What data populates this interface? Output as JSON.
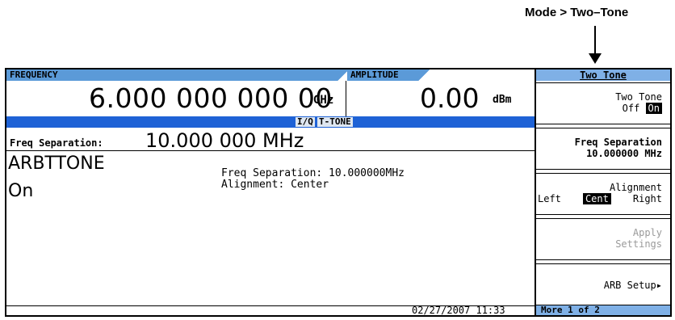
{
  "callout": {
    "label": "Mode > Two–Tone"
  },
  "display": {
    "frequency_label": "FREQUENCY",
    "frequency_value": "6.000 000 000 00",
    "frequency_unit": "GHz",
    "amplitude_label": "AMPLITUDE",
    "amplitude_value": "0.00",
    "amplitude_unit": "dBm",
    "annunciators": [
      "I/Q",
      "T-TONE"
    ],
    "freq_sep_label": "Freq Separation:",
    "freq_sep_value": "10.000 000 MHz",
    "mode_name": "ARBTTONE",
    "mode_state": "On",
    "info_line1": "Freq Separation: 10.000000MHz",
    "info_line2": "Alignment: Center",
    "datetime": "02/27/2007 11:33"
  },
  "menu": {
    "title": "Two Tone",
    "softkeys": [
      {
        "line1": "Two Tone",
        "off": "Off",
        "on": "On"
      },
      {
        "line1": "Freq Separation",
        "line2": "10.000000 MHz"
      },
      {
        "line1": "Alignment",
        "left": "Left",
        "cent": "Cent",
        "right": "Right"
      },
      {
        "line1": "Apply",
        "line2": "Settings"
      },
      {
        "line1": "ARB Setup"
      }
    ],
    "more": "More 1 of 2"
  },
  "colors": {
    "label_blue": "#5b9ad8",
    "status_blue": "#1e62d6",
    "menu_blue": "#7fb0e6"
  }
}
